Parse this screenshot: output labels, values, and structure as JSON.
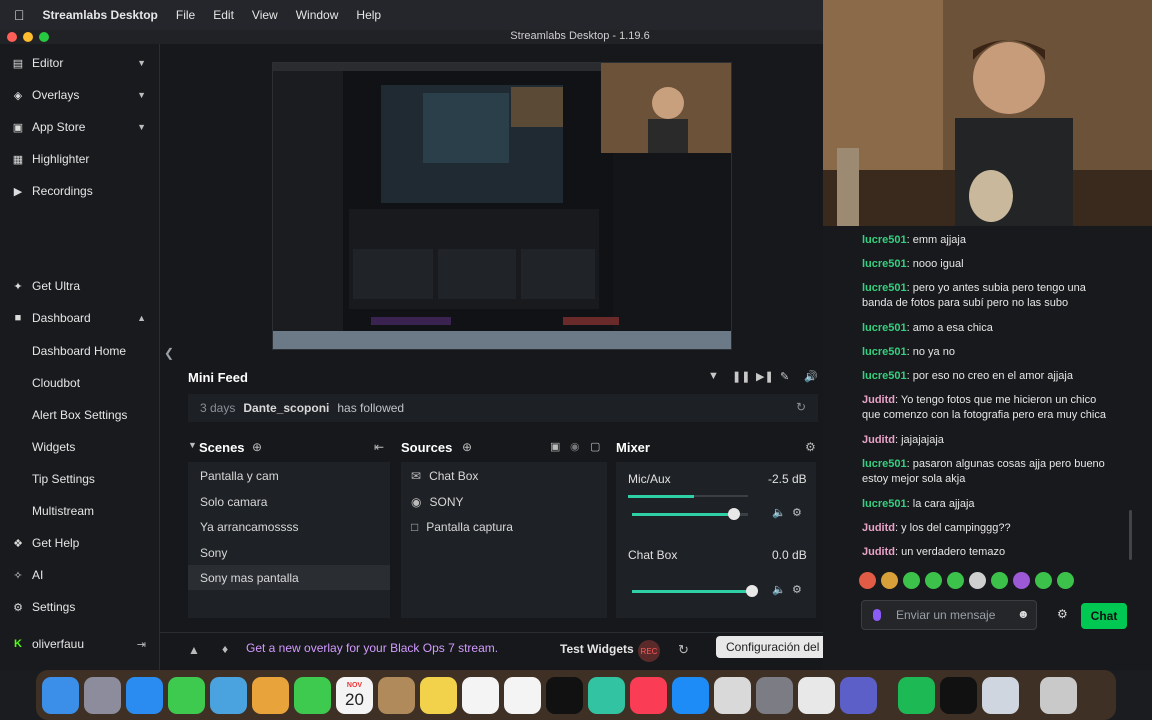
{
  "menubar": {
    "app_name": "Streamlabs Desktop",
    "menus": [
      "File",
      "Edit",
      "View",
      "Window",
      "Help"
    ]
  },
  "window": {
    "title": "Streamlabs Desktop - 1.19.6"
  },
  "sidebar": {
    "top_items": [
      {
        "label": "Editor",
        "icon": "editor-icon",
        "expanded": false
      },
      {
        "label": "Overlays",
        "icon": "overlays-icon",
        "expanded": false
      },
      {
        "label": "App Store",
        "icon": "app-store-icon",
        "expanded": false
      },
      {
        "label": "Highlighter",
        "icon": "highlighter-icon"
      },
      {
        "label": "Recordings",
        "icon": "recordings-icon"
      }
    ],
    "bottom_items": [
      {
        "label": "Get Ultra",
        "icon": "ultra-icon"
      },
      {
        "label": "Dashboard",
        "icon": "dashboard-icon",
        "expanded": true
      },
      {
        "label": "Dashboard Home"
      },
      {
        "label": "Cloudbot"
      },
      {
        "label": "Alert Box Settings"
      },
      {
        "label": "Widgets"
      },
      {
        "label": "Tip Settings"
      },
      {
        "label": "Multistream"
      },
      {
        "label": "Get Help",
        "icon": "help-icon"
      },
      {
        "label": "AI",
        "icon": "ai-icon"
      },
      {
        "label": "Settings",
        "icon": "gear-icon"
      },
      {
        "label": "oliverfauu",
        "icon": "kick-logo-icon"
      }
    ]
  },
  "minifeed": {
    "title": "Mini Feed",
    "event": {
      "time": "3 days",
      "user": "Dante_scoponi",
      "action": "has followed"
    }
  },
  "scenes": {
    "title": "Scenes",
    "items": [
      "Pantalla y cam",
      "Solo camara",
      "Ya arrancamossss",
      "Sony",
      "Sony mas pantalla"
    ],
    "active_index": 4
  },
  "sources": {
    "title": "Sources",
    "items": [
      {
        "label": "Chat Box",
        "icon": "chat-source-icon"
      },
      {
        "label": "SONY",
        "icon": "webcam-source-icon"
      },
      {
        "label": "Pantalla captura",
        "icon": "display-capture-icon"
      }
    ]
  },
  "mixer": {
    "title": "Mixer",
    "channels": [
      {
        "label": "Mic/Aux",
        "db": "-2.5 dB",
        "level": 0.88,
        "meter": 0.55
      },
      {
        "label": "Chat Box",
        "db": "0.0 dB",
        "level": 1.0,
        "meter": 0.0
      }
    ]
  },
  "bottombar": {
    "promo": "Get a new overlay for your Black Ops 7 stream.",
    "test_widgets": "Test Widgets",
    "rec_label": "REC"
  },
  "tooltip": "Configuración del Sistema",
  "chat": {
    "messages": [
      {
        "user": "lucre501",
        "text": "emm ajjaja",
        "color": "#35d07f"
      },
      {
        "user": "lucre501",
        "text": "nooo igual",
        "color": "#35d07f"
      },
      {
        "user": "lucre501",
        "text": "pero yo antes subia pero tengo una banda de fotos para subí pero no las subo",
        "color": "#35d07f"
      },
      {
        "user": "lucre501",
        "text": "amo a esa chica",
        "color": "#35d07f"
      },
      {
        "user": "lucre501",
        "text": "no ya no",
        "color": "#35d07f"
      },
      {
        "user": "lucre501",
        "text": "por eso no creo en el amor ajjaja",
        "color": "#35d07f"
      },
      {
        "user": "Juditd",
        "text": "Yo tengo fotos que me hicieron un chico que comenzo con la fotografia pero era muy chica",
        "color": "#e9a3c9"
      },
      {
        "user": "Juditd",
        "text": "jajajajaja",
        "color": "#e9a3c9"
      },
      {
        "user": "lucre501",
        "text": "pasaron algunas cosas ajja pero bueno estoy mejor sola akja",
        "color": "#35d07f"
      },
      {
        "user": "lucre501",
        "text": "la cara ajjaja",
        "color": "#35d07f"
      },
      {
        "user": "Juditd",
        "text": "y los del campinggg??",
        "color": "#e9a3c9"
      },
      {
        "user": "Juditd",
        "text": "un verdadero temazo",
        "color": "#e9a3c9"
      }
    ],
    "input_placeholder": "Enviar un mensaje",
    "send_label": "Chat"
  },
  "dock": {
    "calendar_month": "NOV",
    "calendar_day": "20",
    "apps": [
      "finder-icon",
      "launchpad-icon",
      "safari-icon",
      "messages-icon",
      "maps-icon",
      "photos-icon",
      "facetime-icon",
      "calendar-icon",
      "contacts-icon",
      "notes-icon",
      "freeform-icon",
      "reminders-icon",
      "appletv-icon",
      "streamlabs-icon",
      "music-icon",
      "app-store-icon",
      "iphone-mirroring-icon",
      "system-settings-icon",
      "chrome-icon",
      "teams-icon",
      "spotify-icon",
      "chatgpt-icon",
      "preview-icon",
      "trash-icon"
    ]
  }
}
